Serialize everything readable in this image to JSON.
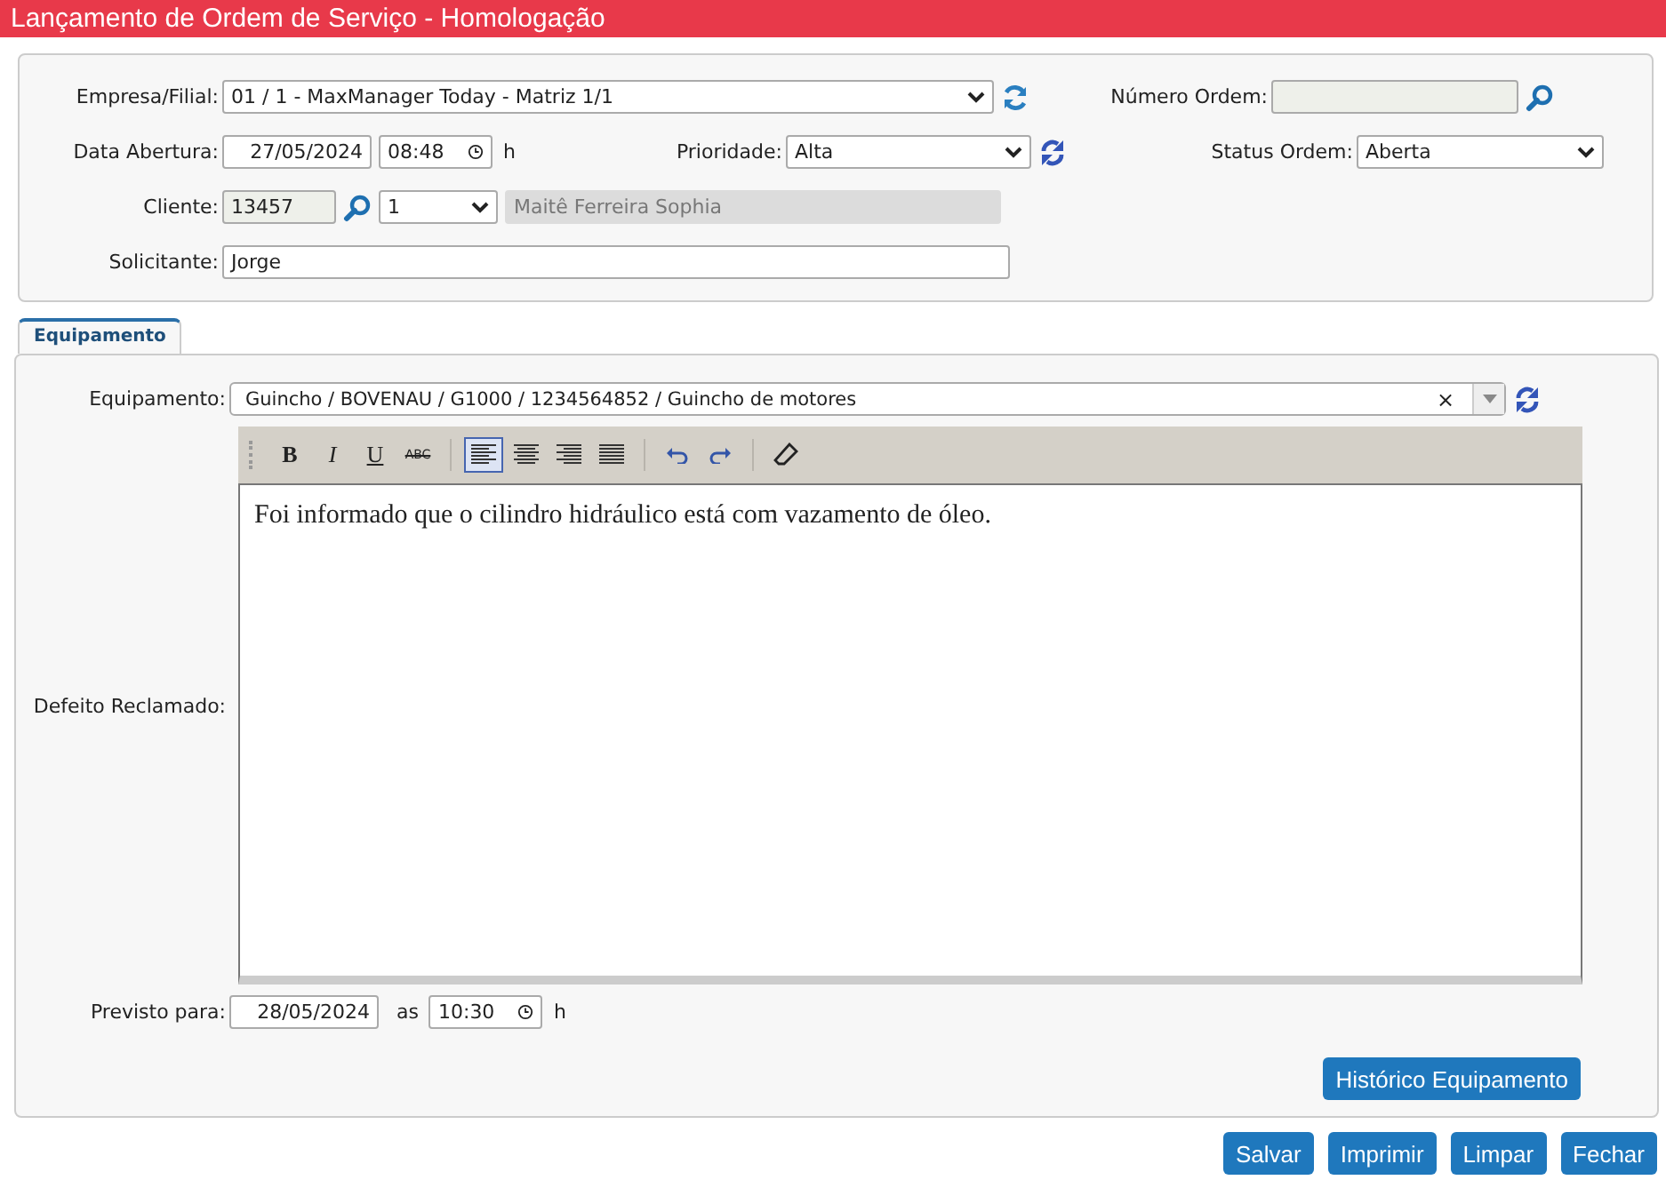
{
  "title": "Lançamento de Ordem de Serviço  - Homologação",
  "header": {
    "empresa": {
      "label": "Empresa/Filial:",
      "value": "01 / 1 - MaxManager Today - Matriz 1/1"
    },
    "numero_ordem": {
      "label": "Número Ordem:"
    },
    "data_abertura": {
      "label": "Data Abertura:",
      "date": "27/05/2024",
      "time": "08:48",
      "unit": "h"
    },
    "prioridade": {
      "label": "Prioridade:",
      "value": "Alta"
    },
    "status_ordem": {
      "label": "Status Ordem:",
      "value": "Aberta"
    },
    "cliente": {
      "label": "Cliente:",
      "code": "13457",
      "branch": "1",
      "name": "Maitê Ferreira Sophia"
    },
    "solicitante": {
      "label": "Solicitante:",
      "value": "Jorge"
    }
  },
  "tabs": [
    {
      "label": "Equipamento",
      "selected": true
    }
  ],
  "equipamento": {
    "label": "Equipamento:",
    "value": "Guincho / BOVENAU / G1000 / 1234564852 / Guincho de motores",
    "clear": "×"
  },
  "defeito": {
    "label": "Defeito Reclamado:",
    "text": "Foi informado que o cilindro hidráulico está com vazamento de óleo.",
    "toolbar": [
      {
        "kind": "bold",
        "label": "B",
        "selected": false
      },
      {
        "kind": "italic",
        "label": "I",
        "selected": false
      },
      {
        "kind": "underline",
        "label": "U",
        "selected": false
      },
      {
        "kind": "strike",
        "label": "ABC",
        "selected": false
      },
      {
        "kind": "align-left",
        "selected": true
      },
      {
        "kind": "align-center",
        "selected": false
      },
      {
        "kind": "align-right",
        "selected": false
      },
      {
        "kind": "justify",
        "selected": false
      },
      {
        "kind": "undo",
        "selected": false
      },
      {
        "kind": "redo",
        "selected": false
      },
      {
        "kind": "eraser",
        "selected": false
      }
    ]
  },
  "previsto": {
    "label": "Previsto para:",
    "date": "28/05/2024",
    "sep": "as",
    "time": "10:30",
    "unit": "h"
  },
  "history_button": "Histórico Equipamento",
  "buttons": [
    "Salvar",
    "Imprimir",
    "Limpar",
    "Fechar"
  ]
}
